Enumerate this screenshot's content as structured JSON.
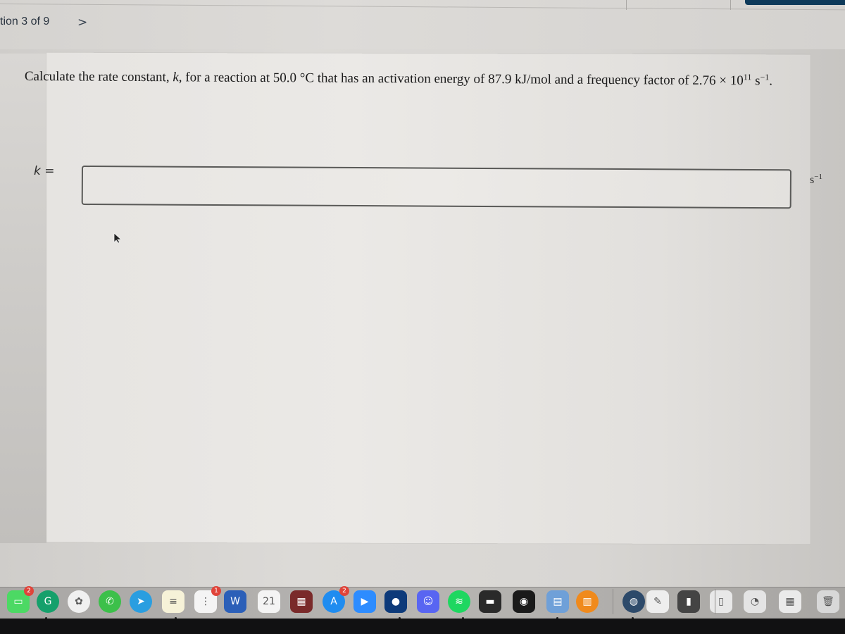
{
  "nav": {
    "question_progress": "tion 3 of 9",
    "next_icon": "chevron-right-icon",
    "next_glyph": ">"
  },
  "question": {
    "text_part1": "Calculate the rate constant, ",
    "var_k": "k",
    "text_part2": ", for a reaction at 50.0 °C that has an activation energy of 87.9 kJ/mol and a frequency factor of 2.76 × 10",
    "exponent": "11",
    "text_part3": " s",
    "unit_exponent": "−1",
    "text_part4": "."
  },
  "answer": {
    "label_var": "k",
    "label_eq": " =",
    "value": "",
    "placeholder": "",
    "unit_base": "s",
    "unit_exponent": "−1"
  },
  "colors": {
    "accent_tab": "#0e3a5a",
    "badge_red": "#e0443a"
  },
  "dock": {
    "items": [
      {
        "name": "facetime-icon",
        "glyph": "▭",
        "color": "#4cd964",
        "badge": "2"
      },
      {
        "name": "grammarly-icon",
        "glyph": "G",
        "color": "#15a06b",
        "badge": ""
      },
      {
        "name": "photos-icon",
        "glyph": "✿",
        "color": "#f0f0f0",
        "badge": ""
      },
      {
        "name": "whatsapp-icon",
        "glyph": "✆",
        "color": "#3cc04a",
        "badge": ""
      },
      {
        "name": "telegram-icon",
        "glyph": "➤",
        "color": "#2a9ee0",
        "badge": ""
      },
      {
        "name": "notes-icon",
        "glyph": "≡",
        "color": "#f6f2d8",
        "badge": ""
      },
      {
        "name": "reminders-icon",
        "glyph": "⋮",
        "color": "#f4f4f4",
        "badge": "1"
      },
      {
        "name": "word-icon",
        "glyph": "W",
        "color": "#2b5fb8",
        "badge": ""
      },
      {
        "name": "calendar-icon",
        "glyph": "21",
        "color": "#f4f4f4",
        "badge": ""
      },
      {
        "name": "photo-booth-icon",
        "glyph": "▦",
        "color": "#7a2a2a",
        "badge": ""
      },
      {
        "name": "app-store-icon",
        "glyph": "A",
        "color": "#1f8cf0",
        "badge": "2"
      },
      {
        "name": "zoom-icon",
        "glyph": "▶",
        "color": "#2d8cff",
        "badge": ""
      },
      {
        "name": "golf-app-icon",
        "glyph": "●",
        "color": "#0d3a7a",
        "badge": ""
      },
      {
        "name": "discord-icon",
        "glyph": "☺",
        "color": "#5865f2",
        "badge": ""
      },
      {
        "name": "spotify-icon",
        "glyph": "≋",
        "color": "#1ed760",
        "badge": ""
      },
      {
        "name": "terminal-icon",
        "glyph": "▬",
        "color": "#2a2a2a",
        "badge": ""
      },
      {
        "name": "photo-booth-red-icon",
        "glyph": "◉",
        "color": "#1a1a1a",
        "badge": ""
      },
      {
        "name": "preview-icon",
        "glyph": "▤",
        "color": "#6fa0d8",
        "badge": ""
      },
      {
        "name": "books-icon",
        "glyph": "▥",
        "color": "#f08a1c",
        "badge": ""
      },
      {
        "name": "chrome-downloads-icon",
        "glyph": "◍",
        "color": "#2d4a6a",
        "badge": ""
      },
      {
        "name": "textedit-icon",
        "glyph": "✎",
        "color": "#eeeeee",
        "badge": ""
      },
      {
        "name": "notebook-icon",
        "glyph": "▮",
        "color": "#444444",
        "badge": ""
      },
      {
        "name": "document-stack-icon",
        "glyph": "▯",
        "color": "#e8e8e8",
        "badge": ""
      },
      {
        "name": "chrome-window-icon",
        "glyph": "◔",
        "color": "#e4e4e4",
        "badge": ""
      },
      {
        "name": "spreadsheet-window-icon",
        "glyph": "▦",
        "color": "#eaeaea",
        "badge": ""
      },
      {
        "name": "trash-icon",
        "glyph": "🗑",
        "color": "#d8d8d8",
        "badge": ""
      }
    ]
  }
}
